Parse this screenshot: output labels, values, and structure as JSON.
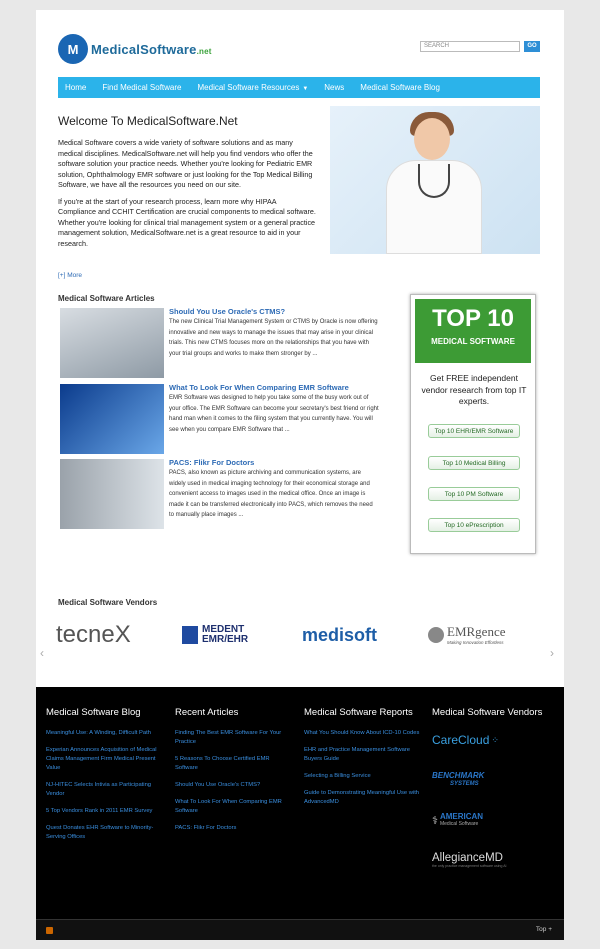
{
  "header": {
    "logo_text": "MedicalSoftware",
    "logo_suffix": ".net",
    "search_placeholder": "SEARCH",
    "search_button": "GO"
  },
  "nav": {
    "items": [
      "Home",
      "Find Medical Software",
      "Medical Software Resources",
      "News",
      "Medical Software Blog"
    ]
  },
  "intro": {
    "title": "Welcome To MedicalSoftware.Net",
    "p1": "Medical Software covers a wide variety of software solutions and as many medical disciplines. MedicalSoftware.net will help you find vendors who offer the software solution your practice needs.  Whether you're looking for Pediatric EMR solution, Ophthalmology EMR software or just looking for the Top Medical Billing Software, we have all the resources you need on our site.",
    "p2": "If you're at the start of your research process, learn more why HIPAA Compliance and CCHIT Certification are crucial components to medical software. Whether you're looking for clinical trial management system or a general practice management solution, MedicalSoftware.net is a great resource to aid in your research.",
    "more": "[+] More"
  },
  "articles": {
    "heading": "Medical Software Articles",
    "items": [
      {
        "title": "Should You Use Oracle's CTMS?",
        "text": "The new Clinical Trial Management System or CTMS by Oracle is now offering innovative and new ways to manage the issues that may arise in your clinical trials. This new CTMS focuses more on the relationships that you have with your trial groups and works to make them stronger by ..."
      },
      {
        "title": "What To Look For When Comparing EMR Software",
        "text": "EMR Software was designed to help you take some of the busy work out of your office. The EMR Software can become your secretary's best friend or right hand man when it comes to the filing system that you currently have. You will see when you compare EMR Software that ..."
      },
      {
        "title": "PACS: Flikr For Doctors",
        "text": "PACS, also known as picture archiving and communication systems, are widely used in medical imaging technology for their economical storage and convenient access to images used in the medical office. Once an image is made it can be transferred electronically into PACS, which removes the need to manually place images ..."
      }
    ]
  },
  "top10": {
    "big": "TOP 10",
    "sub": "MEDICAL SOFTWARE",
    "copy": "Get FREE independent vendor research from top IT experts.",
    "buttons": [
      "Top 10 EHR/EMR Software",
      "Top 10 Medical Billing",
      "Top 10 PM Software",
      "Top 10 ePrescription"
    ]
  },
  "vendors": {
    "heading": "Medical Software Vendors",
    "tecnex": "tecneX",
    "medent1": "MEDENT",
    "medent2": "EMR/EHR",
    "medisoft": "medisoft",
    "emrgence": "EMRgence",
    "emrgence_tag": "Making Innovation Effortless"
  },
  "footer": {
    "blog": {
      "heading": "Medical Software Blog",
      "links": [
        "Meaningful Use: A Winding, Difficult Path",
        "Experian Announces Acquisition of Medical Claims Management Firm Medical Present Value",
        "NJ-HITEC Selects Intivia as Participating Vendor",
        "5 Top Vendors Rank in 2011 EMR Survey",
        "Quest Donates EHR Software to Minority-Serving Offices"
      ]
    },
    "recent": {
      "heading": "Recent Articles",
      "links": [
        "Finding The Best EMR Software For Your Practice",
        "5 Reasons To Choose Certified EMR Software",
        "Should You Use Oracle's CTMS?",
        "What To Look For When Comparing EMR Software",
        "PACS: Flikr For Doctors"
      ]
    },
    "reports": {
      "heading": "Medical Software Reports",
      "links": [
        "What You Should Know About ICD-10 Codes",
        "EHR and Practice Management Software Buyers Guide",
        "Selecting a Billing Service",
        "Guide to Demonstrating Meaningful Use with AdvancedMD"
      ]
    },
    "vendors": {
      "heading": "Medical Software Vendors",
      "carecloud": "CareCloud",
      "benchmark1": "BENCHMARK",
      "benchmark2": "SYSTEMS",
      "american1": "AMERICAN",
      "american2": "Medical Software",
      "allegiance": "AllegianceMD",
      "allegiance_tag": "the only practice management software using AI"
    },
    "top": "Top +"
  }
}
